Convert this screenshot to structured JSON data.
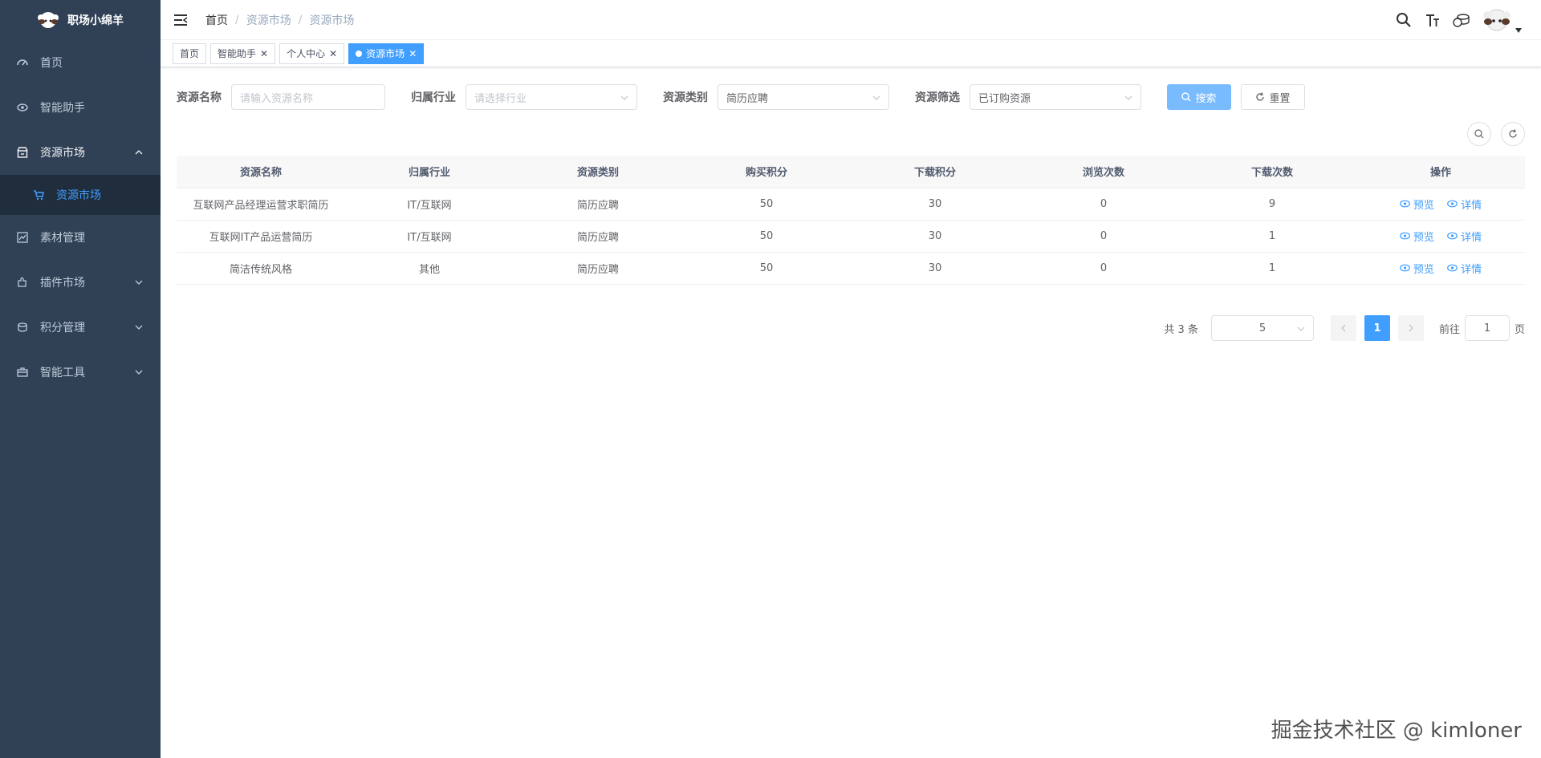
{
  "app": {
    "title": "职场小绵羊"
  },
  "sidebar": {
    "items": [
      {
        "label": "首页",
        "icon": "dashboard-icon"
      },
      {
        "label": "智能助手",
        "icon": "eye-icon"
      },
      {
        "label": "资源市场",
        "icon": "store-icon",
        "open": true
      },
      {
        "label": "素材管理",
        "icon": "chart-icon"
      },
      {
        "label": "插件市场",
        "icon": "puzzle-icon"
      },
      {
        "label": "积分管理",
        "icon": "coins-icon"
      },
      {
        "label": "智能工具",
        "icon": "toolbox-icon"
      }
    ],
    "submenu_active": "资源市场"
  },
  "breadcrumb": [
    "首页",
    "资源市场",
    "资源市场"
  ],
  "tags": [
    {
      "label": "首页",
      "closable": false
    },
    {
      "label": "智能助手",
      "closable": true
    },
    {
      "label": "个人中心",
      "closable": true
    },
    {
      "label": "资源市场",
      "closable": true,
      "active": true
    }
  ],
  "filters": {
    "name_label": "资源名称",
    "name_placeholder": "请输入资源名称",
    "industry_label": "归属行业",
    "industry_placeholder": "请选择行业",
    "category_label": "资源类别",
    "category_value": "简历应聘",
    "screen_label": "资源筛选",
    "screen_value": "已订购资源",
    "search_label": "搜索",
    "reset_label": "重置"
  },
  "table": {
    "headers": [
      "资源名称",
      "归属行业",
      "资源类别",
      "购买积分",
      "下载积分",
      "浏览次数",
      "下载次数",
      "操作"
    ],
    "rows": [
      [
        "互联网产品经理运营求职简历",
        "IT/互联网",
        "简历应聘",
        "50",
        "30",
        "0",
        "9"
      ],
      [
        "互联网IT产品运营简历",
        "IT/互联网",
        "简历应聘",
        "50",
        "30",
        "0",
        "1"
      ],
      [
        "简洁传统风格",
        "其他",
        "简历应聘",
        "50",
        "30",
        "0",
        "1"
      ]
    ],
    "preview_label": "预览",
    "detail_label": "详情"
  },
  "pagination": {
    "total_text": "共 3 条",
    "page_size": "5",
    "current_page": "1",
    "goto_label": "前往",
    "goto_value": "1",
    "page_unit": "页"
  },
  "watermark": "掘金技术社区 @ kimloner",
  "colors": {
    "sidebar": "#304156",
    "primary": "#409eff"
  }
}
